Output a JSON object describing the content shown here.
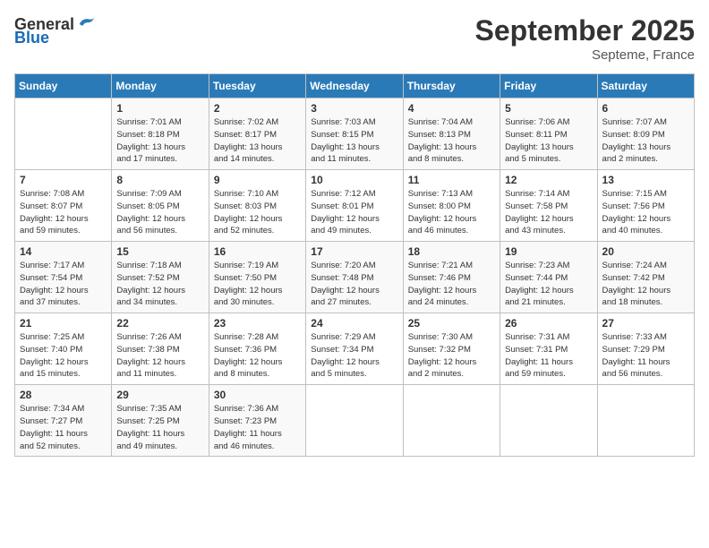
{
  "logo": {
    "general": "General",
    "blue": "Blue"
  },
  "title": "September 2025",
  "location": "Septeme, France",
  "days_header": [
    "Sunday",
    "Monday",
    "Tuesday",
    "Wednesday",
    "Thursday",
    "Friday",
    "Saturday"
  ],
  "weeks": [
    [
      {
        "day": "",
        "info": ""
      },
      {
        "day": "1",
        "info": "Sunrise: 7:01 AM\nSunset: 8:18 PM\nDaylight: 13 hours\nand 17 minutes."
      },
      {
        "day": "2",
        "info": "Sunrise: 7:02 AM\nSunset: 8:17 PM\nDaylight: 13 hours\nand 14 minutes."
      },
      {
        "day": "3",
        "info": "Sunrise: 7:03 AM\nSunset: 8:15 PM\nDaylight: 13 hours\nand 11 minutes."
      },
      {
        "day": "4",
        "info": "Sunrise: 7:04 AM\nSunset: 8:13 PM\nDaylight: 13 hours\nand 8 minutes."
      },
      {
        "day": "5",
        "info": "Sunrise: 7:06 AM\nSunset: 8:11 PM\nDaylight: 13 hours\nand 5 minutes."
      },
      {
        "day": "6",
        "info": "Sunrise: 7:07 AM\nSunset: 8:09 PM\nDaylight: 13 hours\nand 2 minutes."
      }
    ],
    [
      {
        "day": "7",
        "info": "Sunrise: 7:08 AM\nSunset: 8:07 PM\nDaylight: 12 hours\nand 59 minutes."
      },
      {
        "day": "8",
        "info": "Sunrise: 7:09 AM\nSunset: 8:05 PM\nDaylight: 12 hours\nand 56 minutes."
      },
      {
        "day": "9",
        "info": "Sunrise: 7:10 AM\nSunset: 8:03 PM\nDaylight: 12 hours\nand 52 minutes."
      },
      {
        "day": "10",
        "info": "Sunrise: 7:12 AM\nSunset: 8:01 PM\nDaylight: 12 hours\nand 49 minutes."
      },
      {
        "day": "11",
        "info": "Sunrise: 7:13 AM\nSunset: 8:00 PM\nDaylight: 12 hours\nand 46 minutes."
      },
      {
        "day": "12",
        "info": "Sunrise: 7:14 AM\nSunset: 7:58 PM\nDaylight: 12 hours\nand 43 minutes."
      },
      {
        "day": "13",
        "info": "Sunrise: 7:15 AM\nSunset: 7:56 PM\nDaylight: 12 hours\nand 40 minutes."
      }
    ],
    [
      {
        "day": "14",
        "info": "Sunrise: 7:17 AM\nSunset: 7:54 PM\nDaylight: 12 hours\nand 37 minutes."
      },
      {
        "day": "15",
        "info": "Sunrise: 7:18 AM\nSunset: 7:52 PM\nDaylight: 12 hours\nand 34 minutes."
      },
      {
        "day": "16",
        "info": "Sunrise: 7:19 AM\nSunset: 7:50 PM\nDaylight: 12 hours\nand 30 minutes."
      },
      {
        "day": "17",
        "info": "Sunrise: 7:20 AM\nSunset: 7:48 PM\nDaylight: 12 hours\nand 27 minutes."
      },
      {
        "day": "18",
        "info": "Sunrise: 7:21 AM\nSunset: 7:46 PM\nDaylight: 12 hours\nand 24 minutes."
      },
      {
        "day": "19",
        "info": "Sunrise: 7:23 AM\nSunset: 7:44 PM\nDaylight: 12 hours\nand 21 minutes."
      },
      {
        "day": "20",
        "info": "Sunrise: 7:24 AM\nSunset: 7:42 PM\nDaylight: 12 hours\nand 18 minutes."
      }
    ],
    [
      {
        "day": "21",
        "info": "Sunrise: 7:25 AM\nSunset: 7:40 PM\nDaylight: 12 hours\nand 15 minutes."
      },
      {
        "day": "22",
        "info": "Sunrise: 7:26 AM\nSunset: 7:38 PM\nDaylight: 12 hours\nand 11 minutes."
      },
      {
        "day": "23",
        "info": "Sunrise: 7:28 AM\nSunset: 7:36 PM\nDaylight: 12 hours\nand 8 minutes."
      },
      {
        "day": "24",
        "info": "Sunrise: 7:29 AM\nSunset: 7:34 PM\nDaylight: 12 hours\nand 5 minutes."
      },
      {
        "day": "25",
        "info": "Sunrise: 7:30 AM\nSunset: 7:32 PM\nDaylight: 12 hours\nand 2 minutes."
      },
      {
        "day": "26",
        "info": "Sunrise: 7:31 AM\nSunset: 7:31 PM\nDaylight: 11 hours\nand 59 minutes."
      },
      {
        "day": "27",
        "info": "Sunrise: 7:33 AM\nSunset: 7:29 PM\nDaylight: 11 hours\nand 56 minutes."
      }
    ],
    [
      {
        "day": "28",
        "info": "Sunrise: 7:34 AM\nSunset: 7:27 PM\nDaylight: 11 hours\nand 52 minutes."
      },
      {
        "day": "29",
        "info": "Sunrise: 7:35 AM\nSunset: 7:25 PM\nDaylight: 11 hours\nand 49 minutes."
      },
      {
        "day": "30",
        "info": "Sunrise: 7:36 AM\nSunset: 7:23 PM\nDaylight: 11 hours\nand 46 minutes."
      },
      {
        "day": "",
        "info": ""
      },
      {
        "day": "",
        "info": ""
      },
      {
        "day": "",
        "info": ""
      },
      {
        "day": "",
        "info": ""
      }
    ]
  ]
}
